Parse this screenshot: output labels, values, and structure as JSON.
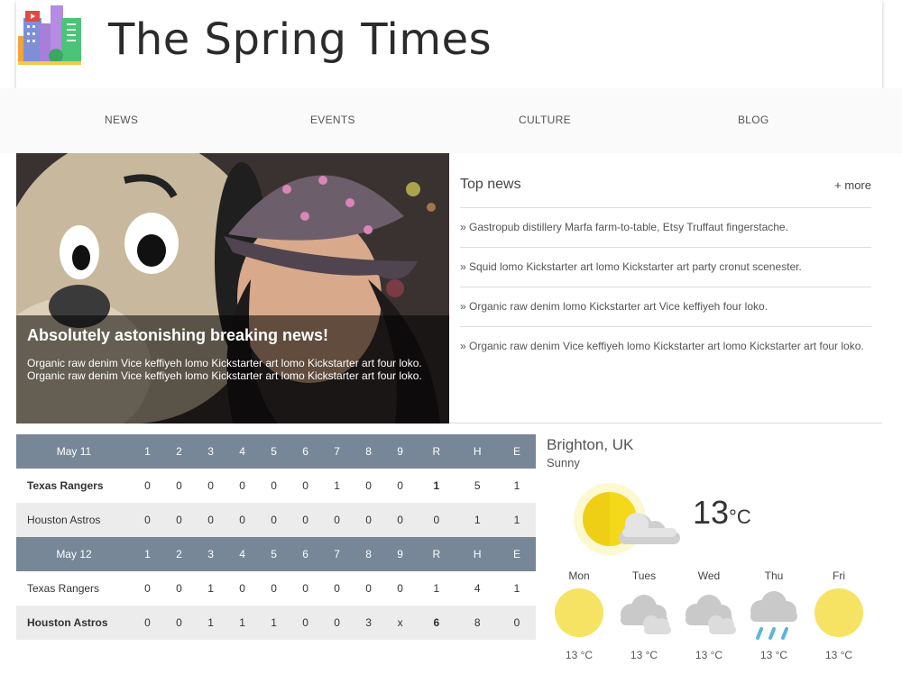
{
  "site": {
    "title": "The Spring Times"
  },
  "nav": [
    {
      "label": "NEWS"
    },
    {
      "label": "EVENTS"
    },
    {
      "label": "CULTURE"
    },
    {
      "label": "BLOG"
    }
  ],
  "hero": {
    "title": "Absolutely astonishing breaking news!",
    "text_line1": "Organic raw denim Vice keffiyeh lomo Kickstarter art lomo Kickstarter art four loko.",
    "text_line2": "Organic raw denim Vice keffiyeh lomo Kickstarter art lomo Kickstarter art four loko."
  },
  "top_news": {
    "title": "Top news",
    "more_label": "+ more",
    "items": [
      "» Gastropub distillery Marfa farm-to-table, Etsy Truffaut fingerstache.",
      "» Squid lomo Kickstarter art lomo Kickstarter art party cronut scenester.",
      "» Organic raw denim lomo Kickstarter art Vice keffiyeh four loko.",
      "» Organic raw denim Vice keffiyeh lomo Kickstarter art lomo Kickstarter art four loko."
    ]
  },
  "scoreboard": {
    "columns": [
      "1",
      "2",
      "3",
      "4",
      "5",
      "6",
      "7",
      "8",
      "9",
      "R",
      "H",
      "E"
    ],
    "games": [
      {
        "date": "May 11",
        "rows": [
          {
            "team": "Texas Rangers",
            "winner": true,
            "scores": [
              "0",
              "0",
              "0",
              "0",
              "0",
              "0",
              "1",
              "0",
              "0",
              "1",
              "5",
              "1"
            ]
          },
          {
            "team": "Houston Astros",
            "winner": false,
            "scores": [
              "0",
              "0",
              "0",
              "0",
              "0",
              "0",
              "0",
              "0",
              "0",
              "0",
              "1",
              "1"
            ]
          }
        ]
      },
      {
        "date": "May 12",
        "rows": [
          {
            "team": "Texas Rangers",
            "winner": false,
            "scores": [
              "0",
              "0",
              "1",
              "0",
              "0",
              "0",
              "0",
              "0",
              "0",
              "1",
              "4",
              "1"
            ]
          },
          {
            "team": "Houston Astros",
            "winner": true,
            "scores": [
              "0",
              "0",
              "1",
              "1",
              "1",
              "0",
              "0",
              "3",
              "x",
              "6",
              "8",
              "0"
            ]
          }
        ]
      }
    ]
  },
  "weather": {
    "city": "Brighton, UK",
    "condition": "Sunny",
    "temp": "13",
    "unit": "°C",
    "main_icon": "sun-cloud-icon",
    "forecast": [
      {
        "day": "Mon",
        "icon": "sun-icon",
        "temp": "13 °C"
      },
      {
        "day": "Tues",
        "icon": "cloud-icon",
        "temp": "13 °C"
      },
      {
        "day": "Wed",
        "icon": "cloud-icon",
        "temp": "13 °C"
      },
      {
        "day": "Thu",
        "icon": "rain-icon",
        "temp": "13 °C"
      },
      {
        "day": "Fri",
        "icon": "sun-icon",
        "temp": "13 °C"
      }
    ]
  },
  "colors": {
    "score_header": "#778797",
    "sun_yellow": "#f6e363",
    "rain_blue": "#5bb6d8"
  }
}
